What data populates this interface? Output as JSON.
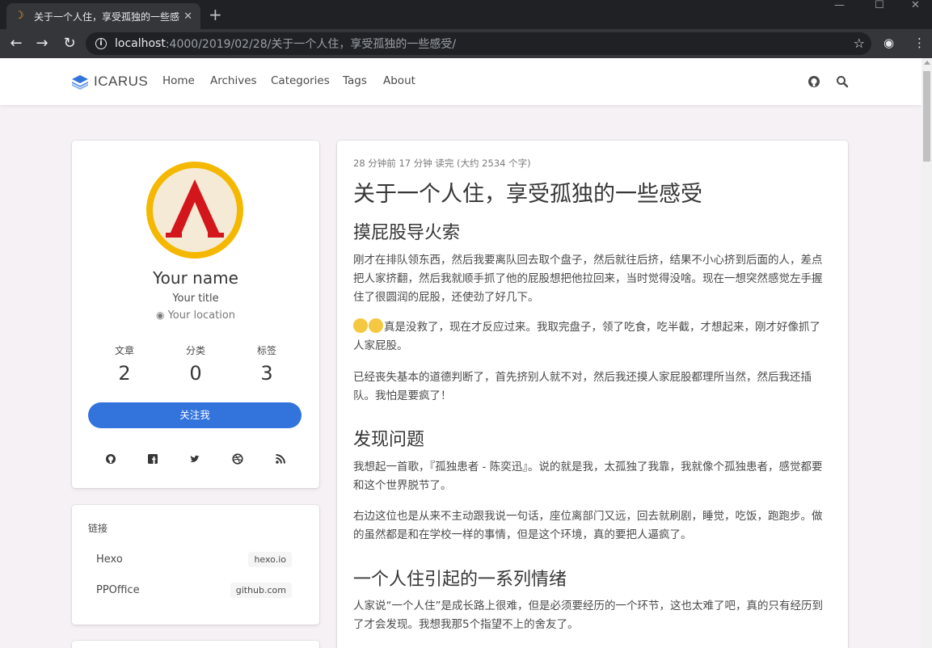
{
  "browser": {
    "tab_title": "关于一个人住，享受孤独的一些感受",
    "url_host": "localhost",
    "url_path": ":4000/2019/02/28/关于一个人住，享受孤独的一些感受/"
  },
  "navbar": {
    "brand": "ICARUS",
    "items": [
      "Home",
      "Archives",
      "Categories",
      "Tags",
      "About"
    ]
  },
  "profile": {
    "name": "Your name",
    "title": "Your title",
    "location": "Your location",
    "stats": [
      {
        "label": "文章",
        "value": "2"
      },
      {
        "label": "分类",
        "value": "0"
      },
      {
        "label": "标签",
        "value": "3"
      }
    ],
    "follow_label": "关注我"
  },
  "links": {
    "title": "链接",
    "items": [
      {
        "name": "Hexo",
        "url": "hexo.io"
      },
      {
        "name": "PPOffice",
        "url": "github.com"
      }
    ]
  },
  "article": {
    "meta": "28 分钟前   17 分钟 读完 (大约 2534 个字)",
    "title": "关于一个人住，享受孤独的一些感受",
    "sections": [
      {
        "heading": "摸屁股导火索",
        "paragraphs": [
          "刚才在排队领东西，然后我要离队回去取个盘子，然后就往后挤，结果不小心挤到后面的人，差点把人家挤翻，然后我就顺手抓了他的屁股想把他拉回来，当时觉得没啥。现在一想突然感觉左手握住了很圆润的屁股，还使劲了好几下。",
          "真是没救了，现在才反应过来。我取完盘子，领了吃食，吃半截，才想起来，刚才好像抓了人家屁股。",
          "已经丧失基本的道德判断了，首先挤别人就不对，然后我还摸人家屁股都理所当然，然后我还插队。我怕是要疯了！"
        ]
      },
      {
        "heading": "发现问题",
        "paragraphs": [
          "我想起一首歌，『孤独患者 - 陈奕迅』。说的就是我，太孤独了我靠，我就像个孤独患者，感觉都要和这个世界脱节了。",
          "右边这位也是从来不主动跟我说一句话，座位离部门又远，回去就刷剧，睡觉，吃饭，跑跑步。做的虽然都是和在学校一样的事情，但是这个环境，真的要把人逼疯了。"
        ]
      },
      {
        "heading": "一个人住引起的一系列情绪",
        "paragraphs": [
          "人家说“一个人住”是成长路上很难，但是必须要经历的一个环节，这也太难了吧，真的只有经历到了才会发现。我想我那5个指望不上的舍友了。"
        ]
      }
    ]
  }
}
